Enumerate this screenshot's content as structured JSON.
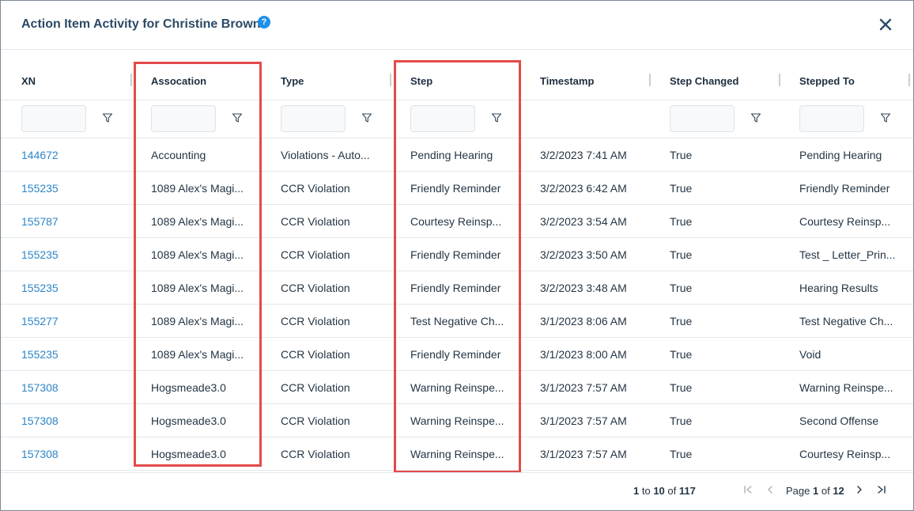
{
  "dialog": {
    "title": "Action Item Activity for Christine Brown",
    "help_glyph": "?"
  },
  "columns": [
    {
      "label": "XN"
    },
    {
      "label": "Assocation"
    },
    {
      "label": "Type"
    },
    {
      "label": "Step"
    },
    {
      "label": "Timestamp"
    },
    {
      "label": "Step Changed"
    },
    {
      "label": "Stepped To"
    }
  ],
  "rows": [
    {
      "xn": "144672",
      "association": "Accounting",
      "type": "Violations - Auto...",
      "step": "Pending Hearing",
      "timestamp": "3/2/2023 7:41 AM",
      "step_changed": "True",
      "stepped_to": "Pending Hearing"
    },
    {
      "xn": "155235",
      "association": "1089 Alex's Magi...",
      "type": "CCR Violation",
      "step": "Friendly Reminder",
      "timestamp": "3/2/2023 6:42 AM",
      "step_changed": "True",
      "stepped_to": "Friendly Reminder"
    },
    {
      "xn": "155787",
      "association": "1089 Alex's Magi...",
      "type": "CCR Violation",
      "step": "Courtesy Reinsp...",
      "timestamp": "3/2/2023 3:54 AM",
      "step_changed": "True",
      "stepped_to": "Courtesy Reinsp..."
    },
    {
      "xn": "155235",
      "association": "1089 Alex's Magi...",
      "type": "CCR Violation",
      "step": "Friendly Reminder",
      "timestamp": "3/2/2023 3:50 AM",
      "step_changed": "True",
      "stepped_to": "Test _ Letter_Prin..."
    },
    {
      "xn": "155235",
      "association": "1089 Alex's Magi...",
      "type": "CCR Violation",
      "step": "Friendly Reminder",
      "timestamp": "3/2/2023 3:48 AM",
      "step_changed": "True",
      "stepped_to": "Hearing Results"
    },
    {
      "xn": "155277",
      "association": "1089 Alex's Magi...",
      "type": "CCR Violation",
      "step": "Test Negative Ch...",
      "timestamp": "3/1/2023 8:06 AM",
      "step_changed": "True",
      "stepped_to": "Test Negative Ch..."
    },
    {
      "xn": "155235",
      "association": "1089 Alex's Magi...",
      "type": "CCR Violation",
      "step": "Friendly Reminder",
      "timestamp": "3/1/2023 8:00 AM",
      "step_changed": "True",
      "stepped_to": "Void"
    },
    {
      "xn": "157308",
      "association": "Hogsmeade3.0",
      "type": "CCR Violation",
      "step": "Warning Reinspe...",
      "timestamp": "3/1/2023 7:57 AM",
      "step_changed": "True",
      "stepped_to": "Warning Reinspe..."
    },
    {
      "xn": "157308",
      "association": "Hogsmeade3.0",
      "type": "CCR Violation",
      "step": "Warning Reinspe...",
      "timestamp": "3/1/2023 7:57 AM",
      "step_changed": "True",
      "stepped_to": "Second Offense"
    },
    {
      "xn": "157308",
      "association": "Hogsmeade3.0",
      "type": "CCR Violation",
      "step": "Warning Reinspe...",
      "timestamp": "3/1/2023 7:57 AM",
      "step_changed": "True",
      "stepped_to": "Courtesy Reinsp..."
    }
  ],
  "pagination": {
    "range_start": "1",
    "to_word": "to",
    "range_end": "10",
    "of_word": "of",
    "total": "117",
    "page_word": "Page",
    "current_page": "1",
    "page_of_word": "of",
    "total_pages": "12"
  },
  "colors": {
    "link": "#2d86c8",
    "highlight": "#e44a4a",
    "title": "#2b4a66",
    "help": "#1e90e8"
  },
  "icons": [
    "help-icon",
    "close-icon",
    "filter-icon",
    "first-page-icon",
    "previous-page-icon",
    "next-page-icon",
    "last-page-icon"
  ]
}
